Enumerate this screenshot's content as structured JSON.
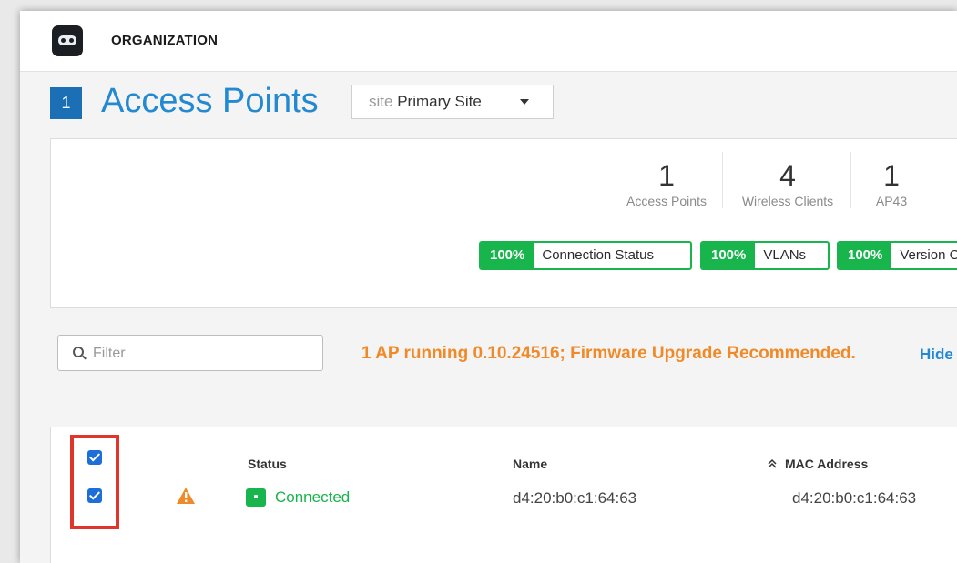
{
  "header": {
    "org_label": "ORGANIZATION"
  },
  "page": {
    "count": "1",
    "title": "Access Points",
    "site_prefix": "site",
    "site_value": "Primary Site"
  },
  "stats": [
    {
      "value": "1",
      "label": "Access Points"
    },
    {
      "value": "4",
      "label": "Wireless Clients"
    },
    {
      "value": "1",
      "label": "AP43"
    }
  ],
  "health": [
    {
      "percent": "100%",
      "label": "Connection Status"
    },
    {
      "percent": "100%",
      "label": "VLANs"
    },
    {
      "percent": "100%",
      "label": "Version Compliance"
    }
  ],
  "filter": {
    "placeholder": "Filter",
    "value": ""
  },
  "firmware_message": "1 AP running 0.10.24516; Firmware Upgrade Recommended.",
  "hide_link": "Hide",
  "table": {
    "columns": [
      "Status",
      "Name",
      "MAC Address"
    ],
    "rows": [
      {
        "status": "Connected",
        "name": "d4:20:b0:c1:64:63",
        "mac": "d4:20:b0:c1:64:63"
      }
    ]
  },
  "colors": {
    "accent": "#2389d1",
    "success": "#17b54c",
    "warning": "#f08a28",
    "highlight": "#e0352a",
    "checkbox": "#1d6ed8"
  }
}
